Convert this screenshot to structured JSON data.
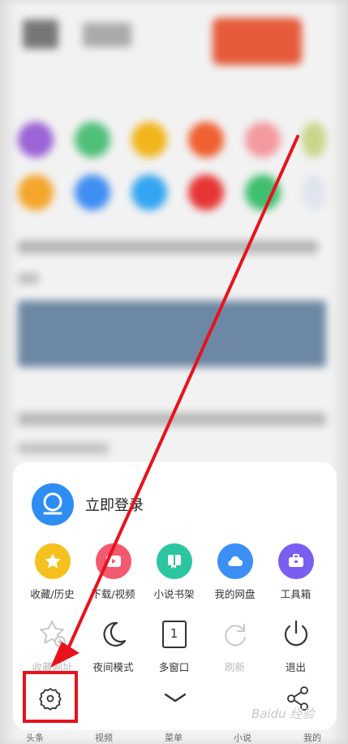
{
  "sheet": {
    "login_label": "立即登录",
    "row1": [
      {
        "label": "收藏/历史",
        "icon": "star-icon",
        "color": "#f6c11f"
      },
      {
        "label": "下载/视频",
        "icon": "download-video-icon",
        "color": "#f35a6f"
      },
      {
        "label": "小说书架",
        "icon": "book-icon",
        "color": "#2bc59f"
      },
      {
        "label": "我的网盘",
        "icon": "cloud-icon",
        "color": "#3b8ff5"
      },
      {
        "label": "工具箱",
        "icon": "toolbox-icon",
        "color": "#7a5ef0"
      }
    ],
    "row2": [
      {
        "label": "收藏网址",
        "icon": "star-add-icon"
      },
      {
        "label": "夜间模式",
        "icon": "moon-icon"
      },
      {
        "label": "多窗口",
        "icon": "multi-window-icon",
        "count": "1"
      },
      {
        "label": "刷新",
        "icon": "refresh-icon"
      },
      {
        "label": "退出",
        "icon": "power-icon"
      }
    ]
  },
  "tabbar": {
    "items": [
      "头条",
      "视频",
      "菜单",
      "小说",
      "我的"
    ]
  },
  "watermark": "Baidu 经验",
  "colors": {
    "accent": "#2d8df2",
    "highlight": "#e8121c"
  }
}
